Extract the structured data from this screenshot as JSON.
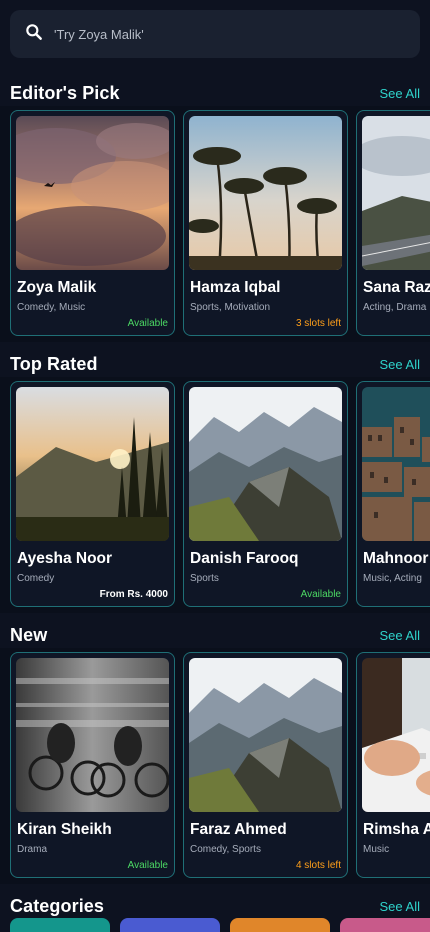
{
  "search": {
    "placeholder": "'Try Zoya Malik'"
  },
  "sections": [
    {
      "title": "Editor's Pick",
      "see_all": "See All",
      "cards": [
        {
          "name": "Zoya Malik",
          "tags": "Comedy, Music",
          "status": "Available",
          "status_color": "#4cd964",
          "image": "cloudy-sky"
        },
        {
          "name": "Hamza Iqbal",
          "tags": "Sports, Motivation",
          "status": "3 slots left",
          "status_color": "#ff9f1a",
          "image": "palm-trees"
        },
        {
          "name": "Sana Raz",
          "tags": "Acting, Drama",
          "status": "",
          "status_color": "",
          "image": "mountain-road"
        }
      ]
    },
    {
      "title": "Top Rated",
      "see_all": "See All",
      "cards": [
        {
          "name": "Ayesha Noor",
          "tags": "Comedy",
          "status": "From Rs. 4000",
          "status_color": "#ffffff",
          "image": "forest-sunset"
        },
        {
          "name": "Danish Farooq",
          "tags": "Sports",
          "status": "Available",
          "status_color": "#4cd964",
          "image": "rocky-mountains"
        },
        {
          "name": "Mahnoor",
          "tags": "Music, Acting",
          "status": "",
          "status_color": "",
          "image": "hillside-town"
        }
      ]
    },
    {
      "title": "New",
      "see_all": "See All",
      "cards": [
        {
          "name": "Kiran Sheikh",
          "tags": "Drama",
          "status": "Available",
          "status_color": "#4cd964",
          "image": "cyclists"
        },
        {
          "name": "Faraz Ahmed",
          "tags": "Comedy, Sports",
          "status": "4 slots left",
          "status_color": "#ff9f1a",
          "image": "rocky-mountains"
        },
        {
          "name": "Rimsha A",
          "tags": "Music",
          "status": "",
          "status_color": "",
          "image": "hands-keyboard"
        }
      ]
    },
    {
      "title": "Categories",
      "see_all": "See All",
      "cards": []
    }
  ],
  "colors": {
    "accent": "#2fd3cb",
    "background": "#0d1220",
    "card_border": "#1f6f76",
    "category_pills": [
      "#14968c",
      "#4a5bd1",
      "#e0862a",
      "#c85a8a"
    ]
  }
}
